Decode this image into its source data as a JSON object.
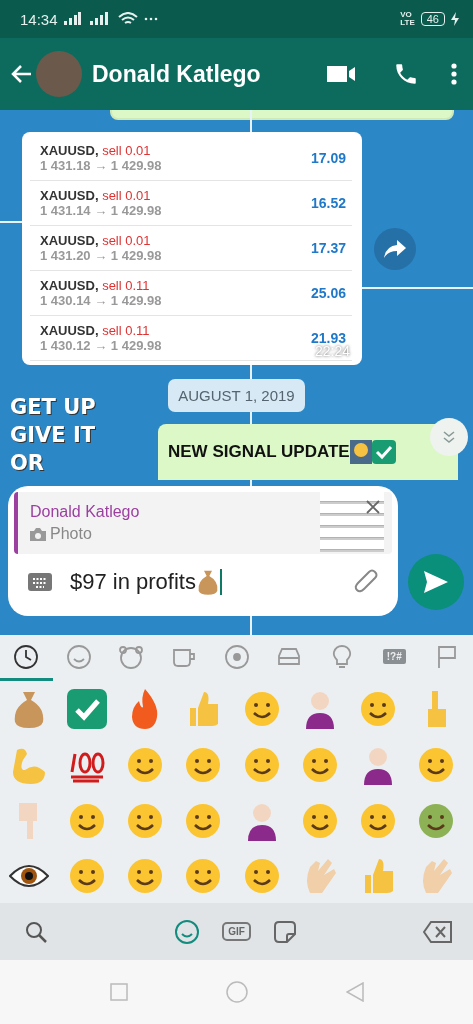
{
  "status_bar": {
    "time": "14:34",
    "volte_top": "VO",
    "volte_bottom": "LTE",
    "battery": "46"
  },
  "header": {
    "name": "Donald Katlego"
  },
  "wallpaper": {
    "lines": [
      "GET UP",
      "GIVE IT",
      "OR"
    ]
  },
  "trades_message": {
    "time": "22:24",
    "trades": [
      {
        "symbol": "XAUUSD,",
        "action": "sell 0.01",
        "prices": "1 431.18 → 1 429.98",
        "profit": "17.09"
      },
      {
        "symbol": "XAUUSD,",
        "action": "sell 0.01",
        "prices": "1 431.14 → 1 429.98",
        "profit": "16.52"
      },
      {
        "symbol": "XAUUSD,",
        "action": "sell 0.01",
        "prices": "1 431.20 → 1 429.98",
        "profit": "17.37"
      },
      {
        "symbol": "XAUUSD,",
        "action": "sell 0.11",
        "prices": "1 430.14 → 1 429.98",
        "profit": "25.06"
      },
      {
        "symbol": "XAUUSD,",
        "action": "sell 0.11",
        "prices": "1 430.12 → 1 429.98",
        "profit": "21.93"
      }
    ]
  },
  "date_chip": "AUGUST 1, 2019",
  "sent_message": {
    "text": "NEW SIGNAL UPDATE"
  },
  "reply_preview": {
    "author": "Donald Katlego",
    "type": "Photo"
  },
  "composer": {
    "value": "$97 in profits"
  },
  "emoji_tabs": [
    {
      "kind": "recent",
      "selected": true
    },
    {
      "kind": "smileys",
      "selected": false
    },
    {
      "kind": "animals",
      "selected": false
    },
    {
      "kind": "food",
      "selected": false
    },
    {
      "kind": "activity",
      "selected": false
    },
    {
      "kind": "travel",
      "selected": false
    },
    {
      "kind": "objects",
      "selected": false
    },
    {
      "kind": "symbols",
      "label": "!?#",
      "selected": false
    },
    {
      "kind": "flags",
      "selected": false
    }
  ],
  "keyboard_bar": {
    "gif": "GIF",
    "emoji_selected": true
  }
}
